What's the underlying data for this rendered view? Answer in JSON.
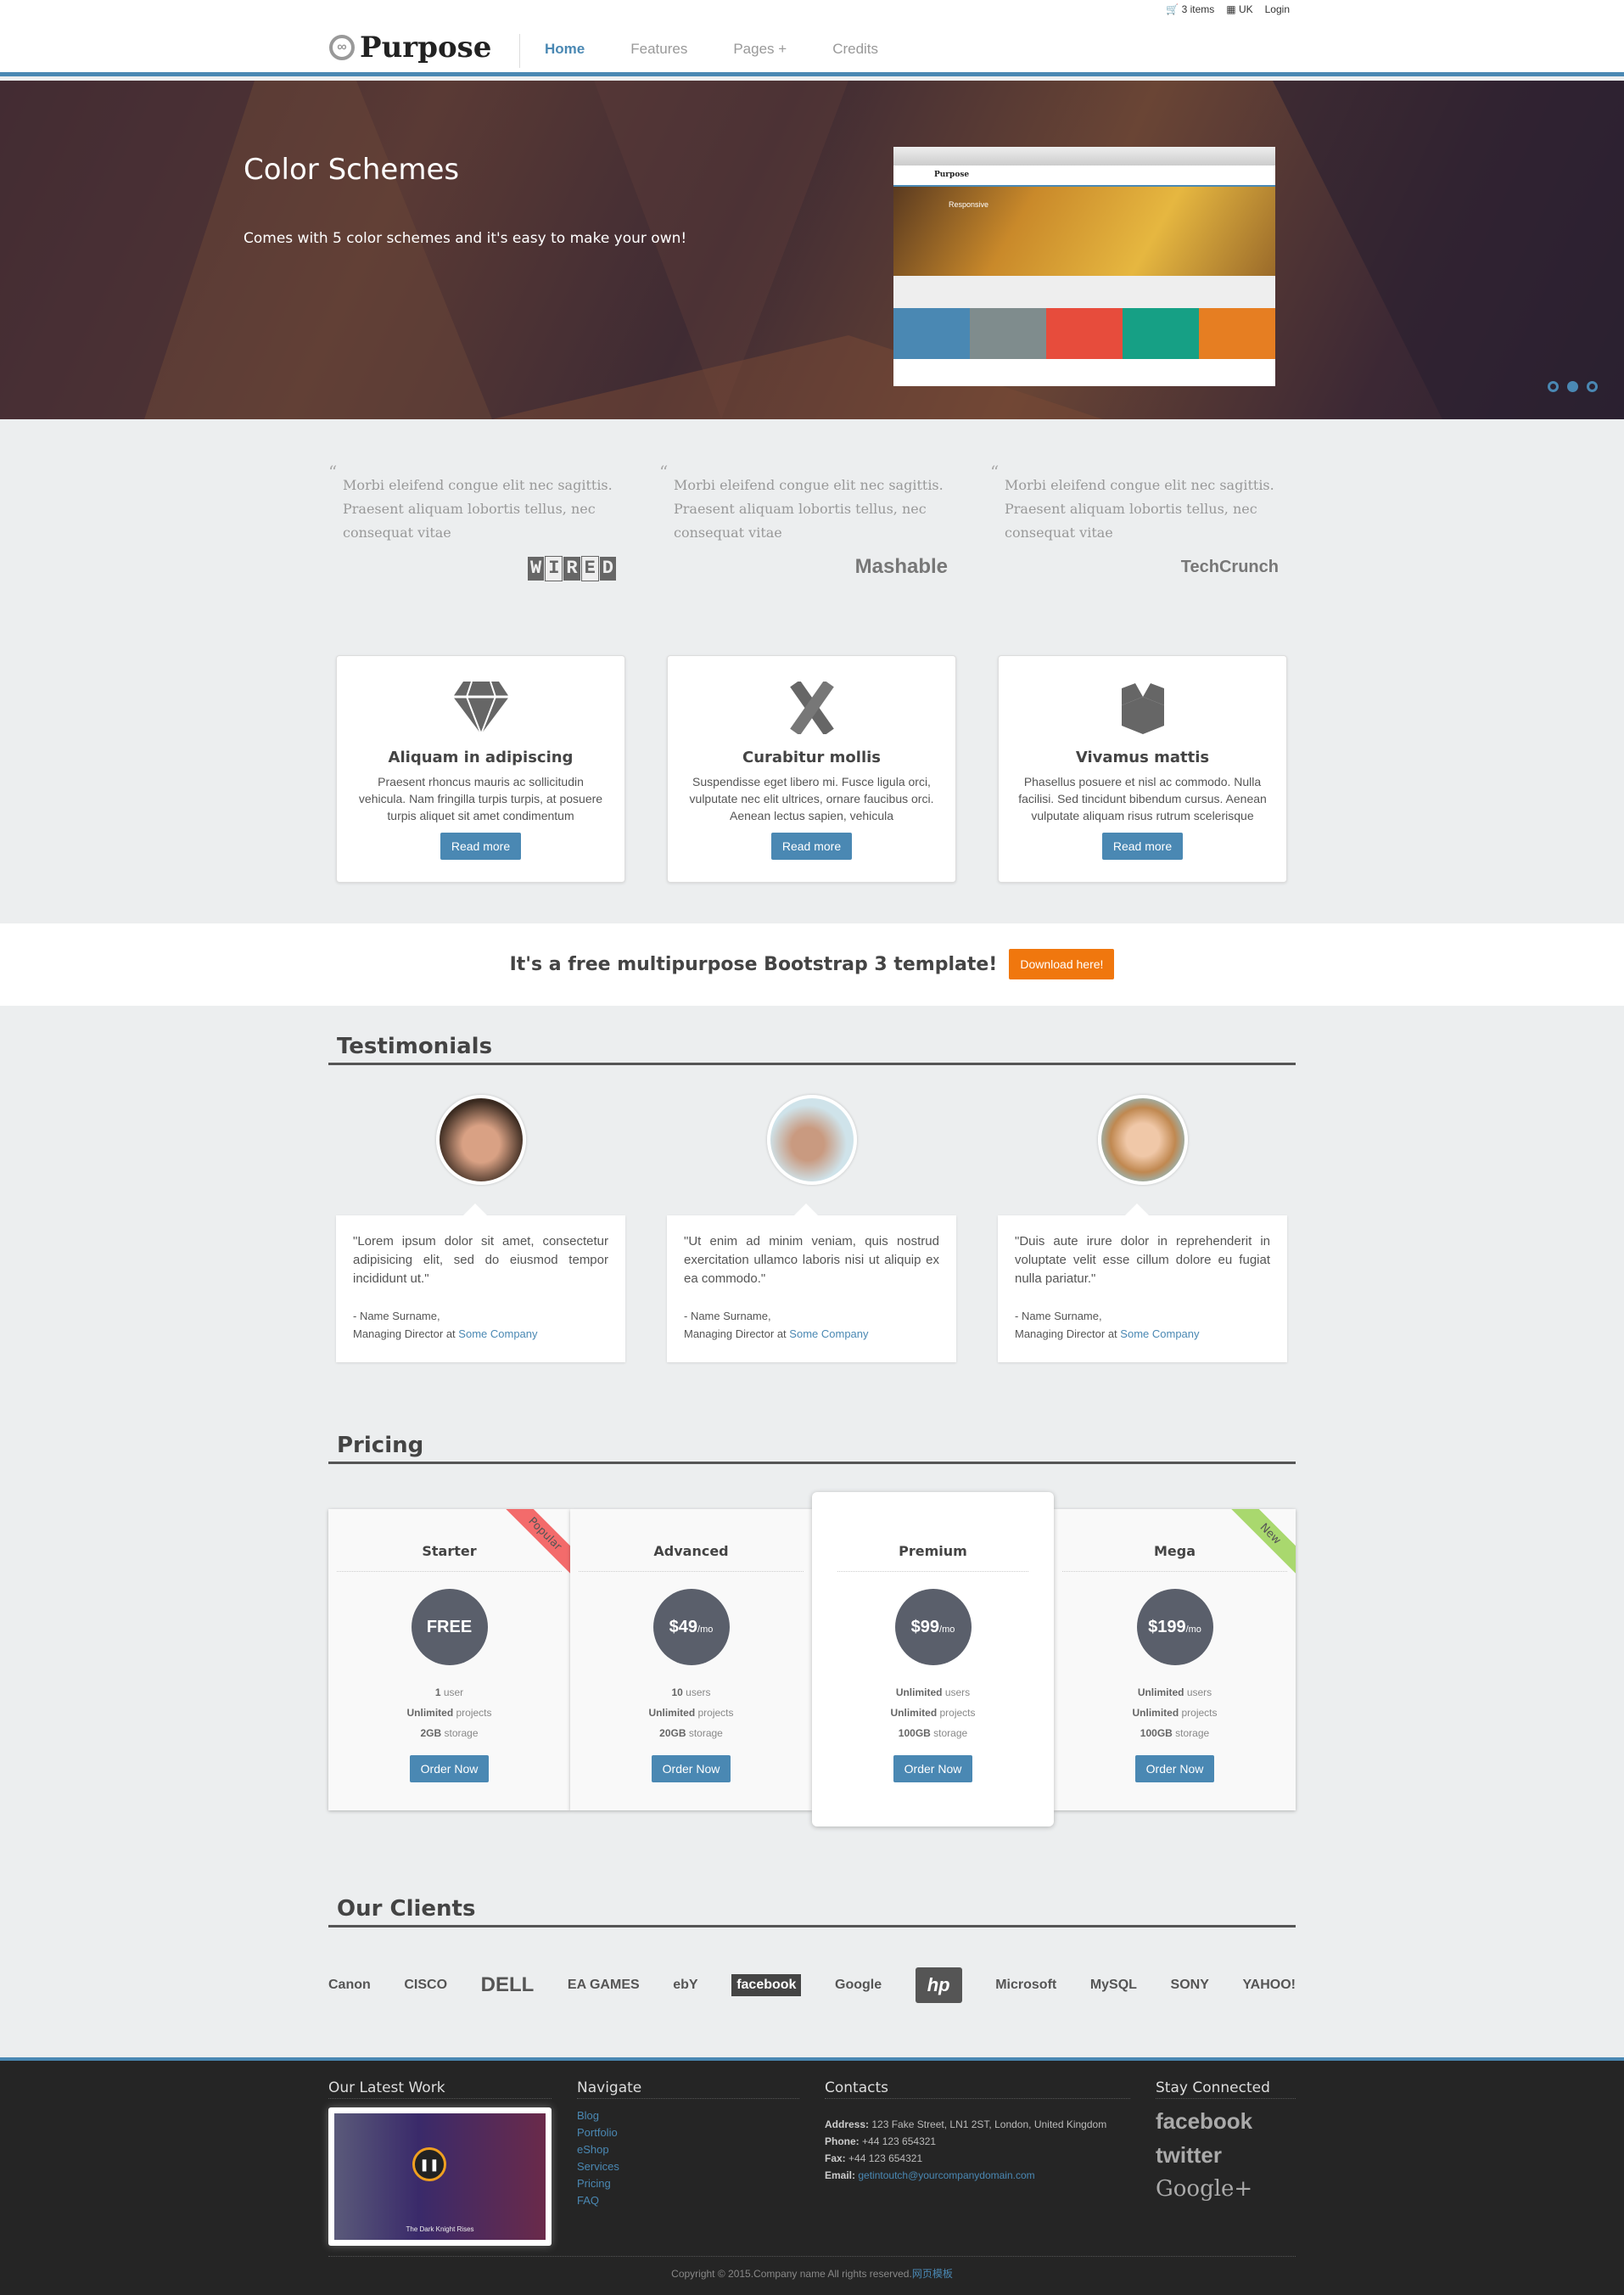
{
  "topbar": {
    "cart": "3 items",
    "lang": "UK",
    "login": "Login"
  },
  "header": {
    "logo": "Purpose",
    "nav": [
      {
        "label": "Home",
        "active": true
      },
      {
        "label": "Features"
      },
      {
        "label": "Pages +"
      },
      {
        "label": "Credits"
      }
    ]
  },
  "hero": {
    "title": "Color Schemes",
    "subtitle": "Comes with 5 color schemes and it's easy to make your own!",
    "preview": {
      "logo": "Purpose",
      "slide": "Responsive"
    },
    "swatches": [
      "#4a88b3",
      "#7f8c8d",
      "#e74c3c",
      "#16a085",
      "#e67e22"
    ],
    "slides": 3,
    "active_slide": 2
  },
  "quotes": [
    {
      "text": "Morbi eleifend congue elit nec sagittis. Praesent aliquam lobortis tellus, nec consequat vitae",
      "brand": "WIRED"
    },
    {
      "text": "Morbi eleifend congue elit nec sagittis. Praesent aliquam lobortis tellus, nec consequat vitae",
      "brand": "Mashable"
    },
    {
      "text": "Morbi eleifend congue elit nec sagittis. Praesent aliquam lobortis tellus, nec consequat vitae",
      "brand": "TechCrunch"
    }
  ],
  "features": [
    {
      "icon": "diamond-icon",
      "title": "Aliquam in adipiscing",
      "text": "Praesent rhoncus mauris ac sollicitudin vehicula. Nam fringilla turpis turpis, at posuere turpis aliquet sit amet condimentum",
      "button": "Read more"
    },
    {
      "icon": "pencil-ruler-icon",
      "title": "Curabitur mollis",
      "text": "Suspendisse eget libero mi. Fusce ligula orci, vulputate nec elit ultrices, ornare faucibus orci. Aenean lectus sapien, vehicula",
      "button": "Read more"
    },
    {
      "icon": "box-icon",
      "title": "Vivamus mattis",
      "text": "Phasellus posuere et nisl ac commodo. Nulla facilisi. Sed tincidunt bibendum cursus. Aenean vulputate aliquam risus rutrum scelerisque",
      "button": "Read more"
    }
  ],
  "banner": {
    "text": "It's a free multipurpose Bootstrap 3 template!",
    "button": "Download here!",
    "accent": "#f0770e"
  },
  "testimonials": {
    "heading": "Testimonials",
    "items": [
      {
        "quote": "\"Lorem ipsum dolor sit amet, consectetur adipisicing elit, sed do eiusmod tempor incididunt ut.\"",
        "name": "- Name Surname,",
        "role": "Managing Director at",
        "company": "Some Company"
      },
      {
        "quote": "\"Ut enim ad minim veniam, quis nostrud exercitation ullamco laboris nisi ut aliquip ex ea commodo.\"",
        "name": "- Name Surname,",
        "role": "Managing Director at",
        "company": "Some Company"
      },
      {
        "quote": "\"Duis aute irure dolor in reprehenderit in voluptate velit esse cillum dolore eu fugiat nulla pariatur.\"",
        "name": "- Name Surname,",
        "role": "Managing Director at",
        "company": "Some Company"
      }
    ]
  },
  "pricing": {
    "heading": "Pricing",
    "plans": [
      {
        "name": "Starter",
        "price": "FREE",
        "unit": "",
        "f1b": "1",
        "f1": " user",
        "f2b": "Unlimited",
        "f2": " projects",
        "f3b": "2GB",
        "f3": " storage",
        "button": "Order Now",
        "ribbon": "Popular",
        "ribbon_color": "#f36b6b"
      },
      {
        "name": "Advanced",
        "price": "$49",
        "unit": "/mo",
        "f1b": "10",
        "f1": " users",
        "f2b": "Unlimited",
        "f2": " projects",
        "f3b": "20GB",
        "f3": " storage",
        "button": "Order Now"
      },
      {
        "name": "Premium",
        "price": "$99",
        "unit": "/mo",
        "f1b": "Unlimited",
        "f1": " users",
        "f2b": "Unlimited",
        "f2": " projects",
        "f3b": "100GB",
        "f3": " storage",
        "button": "Order Now",
        "highlighted": true
      },
      {
        "name": "Mega",
        "price": "$199",
        "unit": "/mo",
        "f1b": "Unlimited",
        "f1": " users",
        "f2b": "Unlimited",
        "f2": " projects",
        "f3b": "100GB",
        "f3": " storage",
        "button": "Order Now",
        "ribbon": "New",
        "ribbon_color": "#a9d86e"
      }
    ]
  },
  "clients": {
    "heading": "Our Clients",
    "logos": [
      "Canon",
      "CISCO",
      "DELL",
      "EA GAMES",
      "ebY",
      "facebook",
      "Google",
      "hp",
      "Microsoft",
      "MySQL",
      "SONY",
      "YAHOO!"
    ]
  },
  "footer": {
    "latest_heading": "Our Latest Work",
    "latest_caption": "The Dark Knight Rises",
    "nav_heading": "Navigate",
    "nav": [
      "Blog",
      "Portfolio",
      "eShop",
      "Services",
      "Pricing",
      "FAQ"
    ],
    "contacts_heading": "Contacts",
    "address_label": "Address:",
    "address": "123 Fake Street, LN1 2ST, London, United Kingdom",
    "phone_label": "Phone:",
    "phone": "+44 123 654321",
    "fax_label": "Fax:",
    "fax": "+44 123 654321",
    "email_label": "Email:",
    "email": "getintoutch@yourcompanydomain.com",
    "social_heading": "Stay Connected",
    "social": [
      "facebook",
      "twitter",
      "Google+"
    ],
    "copyright": "Copyright © 2015.Company name All rights reserved.",
    "copyright_link": "网页模板"
  }
}
